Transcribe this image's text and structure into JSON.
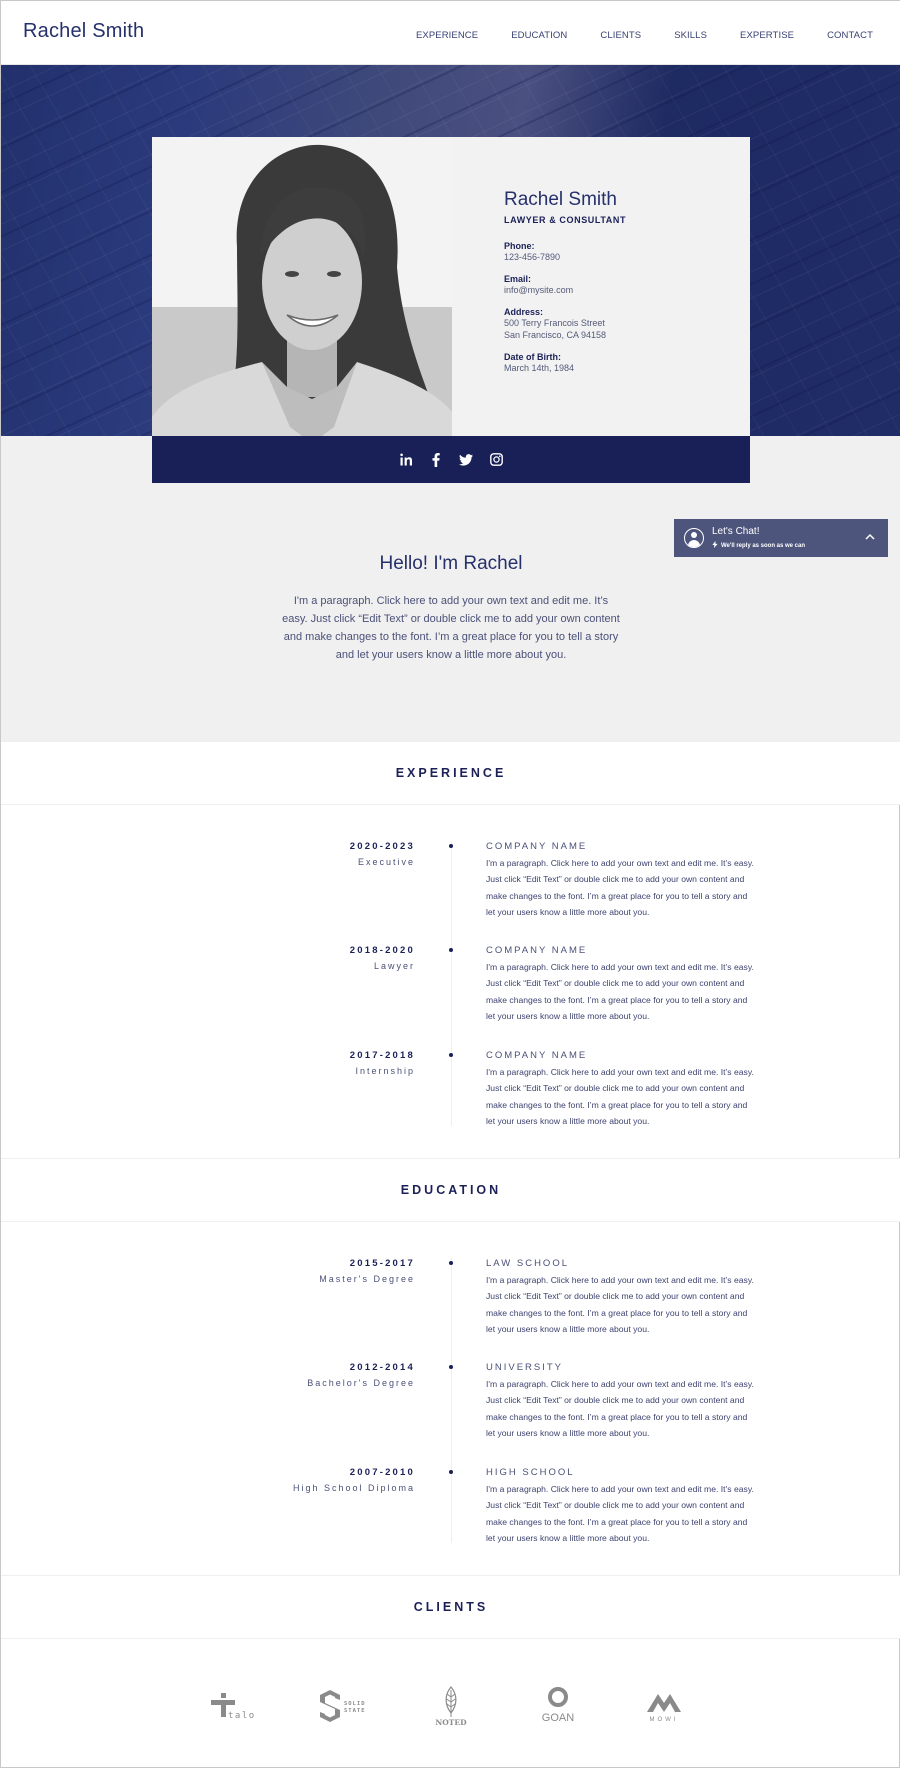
{
  "header": {
    "logo": "Rachel Smith",
    "nav": [
      "EXPERIENCE",
      "EDUCATION",
      "CLIENTS",
      "SKILLS",
      "EXPERTISE",
      "CONTACT"
    ]
  },
  "profile": {
    "name": "Rachel Smith",
    "role": "LAWYER & CONSULTANT",
    "phone_label": "Phone:",
    "phone": "123-456-7890",
    "email_label": "Email:",
    "email": "info@mysite.com",
    "address_label": "Address:",
    "address_line1": "500 Terry Francois Street",
    "address_line2": "San Francisco, CA 94158",
    "dob_label": "Date of Birth:",
    "dob": "March 14th, 1984",
    "social": [
      "linkedin-icon",
      "facebook-icon",
      "twitter-icon",
      "instagram-icon"
    ]
  },
  "intro": {
    "title": "Hello! I'm Rachel",
    "text": "I'm a paragraph. Click here to add your own text and edit me. It’s easy. Just click “Edit Text” or double click me to add your own content and make changes to the font. I’m a great place for you to tell a story and let your users know a little more about you."
  },
  "chat": {
    "title": "Let's Chat!",
    "subtitle": "We'll reply as soon as we can"
  },
  "experience": {
    "title": "EXPERIENCE",
    "items": [
      {
        "years": "2020-2023",
        "sub": "Executive",
        "head": "COMPANY NAME",
        "text": "I'm a paragraph. Click here to add your own text and edit me. It’s easy. Just click “Edit Text” or double click me to add your own content and make changes to the font. I’m a great place for you to tell a story and let your users know a little more about you."
      },
      {
        "years": "2018-2020",
        "sub": "Lawyer",
        "head": "COMPANY NAME",
        "text": "I'm a paragraph. Click here to add your own text and edit me. It’s easy. Just click “Edit Text” or double click me to add your own content and make changes to the font. I’m a great place for you to tell a story and let your users know a little more about you."
      },
      {
        "years": "2017-2018",
        "sub": "Internship",
        "head": "COMPANY NAME",
        "text": "I'm a paragraph. Click here to add your own text and edit me. It’s easy. Just click “Edit Text” or double click me to add your own content and make changes to the font. I’m a great place for you to tell a story and let your users know a little more about you."
      }
    ]
  },
  "education": {
    "title": "EDUCATION",
    "items": [
      {
        "years": "2015-2017",
        "sub": "Master's Degree",
        "head": "LAW SCHOOL",
        "text": "I'm a paragraph. Click here to add your own text and edit me. It’s easy. Just click “Edit Text” or double click me to add your own content and make changes to the font. I’m a great place for you to tell a story and let your users know a little more about you."
      },
      {
        "years": "2012-2014",
        "sub": "Bachelor's Degree",
        "head": "UNIVERSITY",
        "text": "I'm a paragraph. Click here to add your own text and edit me. It’s easy. Just click “Edit Text” or double click me to add your own content and make changes to the font. I’m a great place for you to tell a story and let your users know a little more about you."
      },
      {
        "years": "2007-2010",
        "sub": "High School Diploma",
        "head": "HIGH SCHOOL",
        "text": "I'm a paragraph. Click here to add your own text and edit me. It’s easy. Just click “Edit Text” or double click me to add your own content and make changes to the font. I’m a great place for you to tell a story and let your users know a little more about you."
      }
    ]
  },
  "clients": {
    "title": "CLIENTS",
    "logos": [
      {
        "name": "talo"
      },
      {
        "name": "SOLID STATE",
        "line1": "SOLID",
        "line2": "STATE"
      },
      {
        "name": "NOTED"
      },
      {
        "name": "GOAN"
      },
      {
        "name": "MOWI"
      }
    ]
  },
  "colors": {
    "brand_navy": "#182057",
    "text_navy": "#1b2157",
    "chat_bg": "#4e557d",
    "light_bg": "#f0f0f0",
    "logo_grey": "#8a8a8a"
  }
}
